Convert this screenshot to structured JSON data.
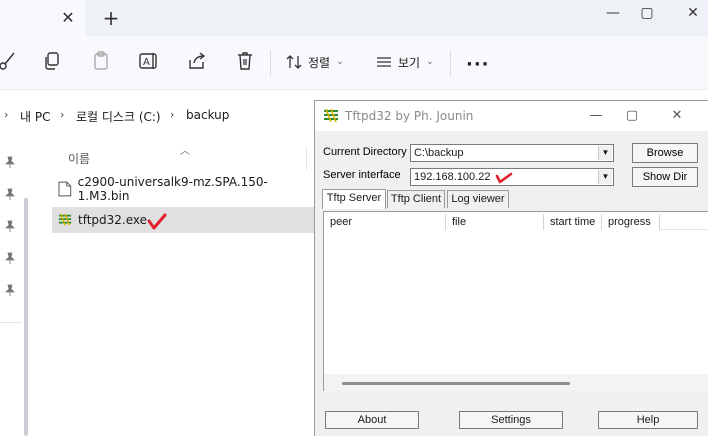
{
  "explorer": {
    "address": {
      "items": [
        "내 PC",
        "로컬 디스크 (C:)",
        "backup"
      ]
    },
    "toolbar": {
      "sort_label": "정렬",
      "view_label": "보기"
    },
    "file_list": {
      "column_name": "이름",
      "files": [
        {
          "name": "c2900-universalk9-mz.SPA.150-1.M3.bin",
          "icon": "file-icon",
          "selected": false
        },
        {
          "name": "tftpd32.exe",
          "icon": "tftpd-app-icon",
          "selected": true
        }
      ]
    }
  },
  "tftpd": {
    "title": "Tftpd32 by Ph. Jounin",
    "current_directory_label": "Current Directory",
    "current_directory_value": "C:\\backup",
    "server_interface_label": "Server interface",
    "server_interface_value": "192.168.100.22",
    "browse_label": "Browse",
    "showdir_label": "Show Dir",
    "tabs": [
      "Tftp Server",
      "Tftp Client",
      "Log viewer"
    ],
    "active_tab": 0,
    "columns": [
      "peer",
      "file",
      "start time",
      "progress"
    ],
    "about_label": "About",
    "settings_label": "Settings",
    "help_label": "Help"
  },
  "colors": {
    "annotation_red": "#e0202a",
    "selection_gray": "#e0e0e0",
    "explorer_bg": "#f7f9fc"
  }
}
